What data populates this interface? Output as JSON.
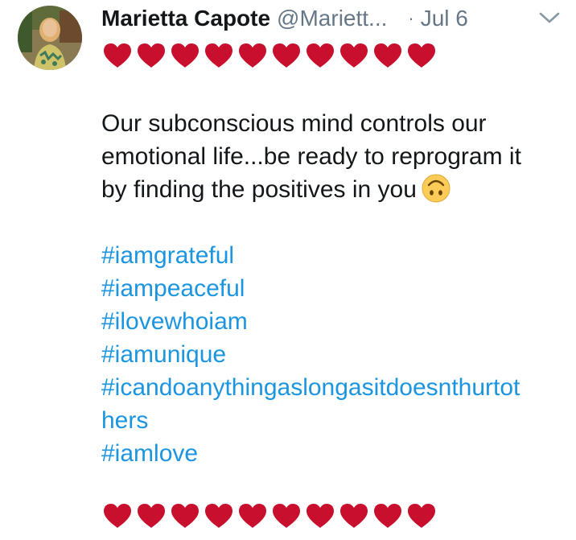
{
  "tweet": {
    "display_name": "Marietta Capote",
    "handle": "@Mariett...",
    "separator": "·",
    "date": "Jul 6",
    "avatar_icon": "profile-photo",
    "caret_icon": "chevron-down-icon",
    "hearts_top_count": 10,
    "hearts_bottom_count": 10,
    "heart_color": "#c8102e",
    "body_lines": [
      "Our subconscious mind controls our",
      "emotional life...be ready to reprogram it",
      "by finding the positives in you"
    ],
    "emoji": "upside-down-face",
    "hashtags": [
      "#iamgrateful",
      "#iampeaceful",
      "#ilovewhoiam",
      "#iamunique",
      "#icandoanythingaslongasitdoesnthurtot",
      "hers",
      "#iamlove"
    ],
    "hashtag_color": "#1b95e0"
  }
}
